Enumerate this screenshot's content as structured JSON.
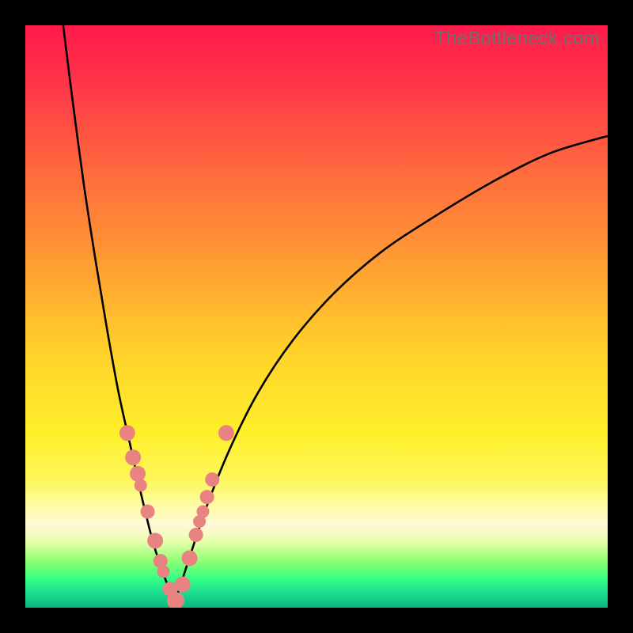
{
  "watermark": "TheBottleneck.com",
  "colors": {
    "frame": "#000000",
    "curve": "#000000",
    "marker_fill": "#e98381",
    "gradient_stops": [
      {
        "offset": 0.0,
        "color": "#ff1a4b"
      },
      {
        "offset": 0.1,
        "color": "#ff3549"
      },
      {
        "offset": 0.25,
        "color": "#ff6a3e"
      },
      {
        "offset": 0.4,
        "color": "#ff9a33"
      },
      {
        "offset": 0.56,
        "color": "#ffd22a"
      },
      {
        "offset": 0.7,
        "color": "#ffef2a"
      },
      {
        "offset": 0.78,
        "color": "#fdf75a"
      },
      {
        "offset": 0.83,
        "color": "#fdfcae"
      },
      {
        "offset": 0.86,
        "color": "#fff8d8"
      },
      {
        "offset": 0.885,
        "color": "#e9ffb0"
      },
      {
        "offset": 0.905,
        "color": "#b6ff8a"
      },
      {
        "offset": 0.925,
        "color": "#7fff74"
      },
      {
        "offset": 0.95,
        "color": "#36ff84"
      },
      {
        "offset": 0.975,
        "color": "#1bdc8e"
      },
      {
        "offset": 1.0,
        "color": "#0bb77d"
      }
    ]
  },
  "chart_data": {
    "type": "line",
    "title": "",
    "xlabel": "",
    "ylabel": "",
    "xlim": [
      0,
      1
    ],
    "ylim": [
      0,
      1
    ],
    "note": "A V-shaped bottleneck curve. Minimum (~0) occurs near x≈0.26; y rises steeply toward 1 at x→0 and gradually toward ~0.8 at x→1. Background gradient encodes y from red (high) to green (low). Axes unlabeled.",
    "series": [
      {
        "name": "bottleneck-curve-left",
        "x": [
          0.065,
          0.08,
          0.1,
          0.12,
          0.14,
          0.16,
          0.18,
          0.2,
          0.22,
          0.24,
          0.257
        ],
        "y": [
          1.0,
          0.88,
          0.73,
          0.6,
          0.48,
          0.37,
          0.28,
          0.19,
          0.11,
          0.05,
          0.01
        ]
      },
      {
        "name": "bottleneck-curve-right",
        "x": [
          0.257,
          0.28,
          0.31,
          0.35,
          0.4,
          0.46,
          0.53,
          0.61,
          0.7,
          0.8,
          0.9,
          1.0
        ],
        "y": [
          0.01,
          0.08,
          0.17,
          0.27,
          0.37,
          0.46,
          0.54,
          0.61,
          0.67,
          0.73,
          0.78,
          0.81
        ]
      }
    ],
    "markers": {
      "name": "highlighted-points",
      "x": [
        0.175,
        0.185,
        0.193,
        0.198,
        0.21,
        0.223,
        0.232,
        0.237,
        0.248,
        0.258,
        0.27,
        0.282,
        0.293,
        0.299,
        0.305,
        0.312,
        0.321,
        0.345
      ],
      "y": [
        0.3,
        0.258,
        0.23,
        0.21,
        0.165,
        0.115,
        0.08,
        0.062,
        0.032,
        0.012,
        0.04,
        0.085,
        0.125,
        0.148,
        0.165,
        0.19,
        0.22,
        0.3
      ],
      "r": [
        10,
        10,
        10,
        8,
        9,
        10,
        9,
        8,
        9,
        11,
        10,
        10,
        9,
        8,
        8,
        9,
        9,
        10
      ]
    }
  }
}
